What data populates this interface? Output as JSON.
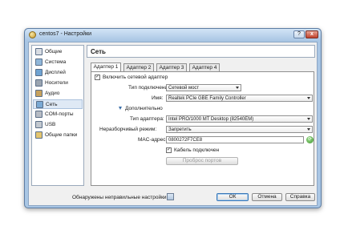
{
  "window": {
    "title": "centos7 - Настройки",
    "help": "?",
    "close": "x"
  },
  "sidebar": {
    "items": [
      {
        "label": "Общие",
        "icon": "general-icon",
        "color": "#d9dde3"
      },
      {
        "label": "Система",
        "icon": "system-icon",
        "color": "#8fb6d9"
      },
      {
        "label": "Дисплей",
        "icon": "display-icon",
        "color": "#6fa3d2"
      },
      {
        "label": "Носители",
        "icon": "storage-icon",
        "color": "#9aa4b0"
      },
      {
        "label": "Аудио",
        "icon": "audio-icon",
        "color": "#c7a15c"
      },
      {
        "label": "Сеть",
        "icon": "network-icon",
        "color": "#7aa9d4",
        "active": true
      },
      {
        "label": "COM-порты",
        "icon": "serial-port-icon",
        "color": "#b7bcc4"
      },
      {
        "label": "USB",
        "icon": "usb-icon",
        "color": "#c2c8cf"
      },
      {
        "label": "Общие папки",
        "icon": "shared-folder-icon",
        "color": "#e4c56e"
      }
    ]
  },
  "section_title": "Сеть",
  "tabs": [
    "Адаптер 1",
    "Адаптер 2",
    "Адаптер 3",
    "Адаптер 4"
  ],
  "adapter": {
    "enable_label": "Включить сетевой адаптер",
    "enable_checked": "✓",
    "connection_type_label": "Тип подключения:",
    "connection_type_value": "Сетевой мост",
    "name_label": "Имя:",
    "name_value": "Realtek PCIe GBE Family Controller",
    "advanced_label": "Дополнительно",
    "adapter_type_label": "Тип адаптера:",
    "adapter_type_value": "Intel PRO/1000 MT Desktop (82540EM)",
    "promiscuous_label": "Неразборчивый режим:",
    "promiscuous_value": "Запретить",
    "mac_label": "MAC-адрес:",
    "mac_value": "0800272F7CE8",
    "cable_label": "Кабель подключен",
    "cable_checked": "✓",
    "port_forwarding_label": "Проброс портов"
  },
  "footer": {
    "invalid_settings": "Обнаружены неправильные настройки",
    "ok": "ОК",
    "cancel": "Отмена",
    "help": "Справка"
  }
}
